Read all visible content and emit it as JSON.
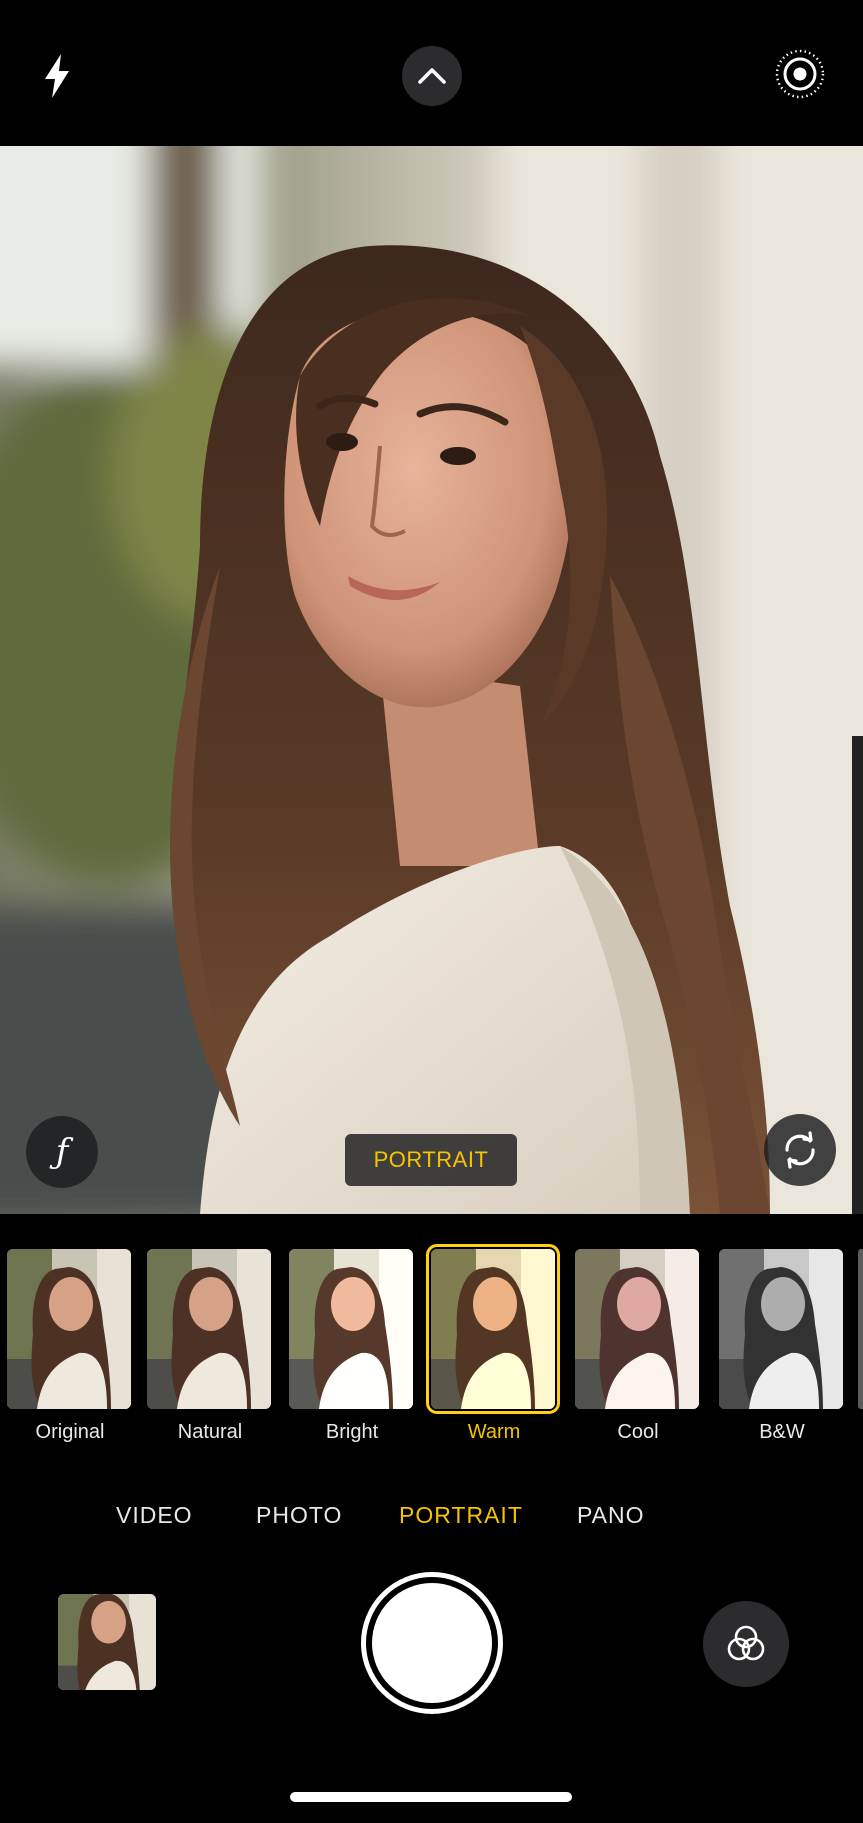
{
  "top_bar": {
    "flash_icon": "lightning-bolt",
    "controls_icon": "chevron-up",
    "live_icon": "concentric-circles"
  },
  "viewfinder": {
    "aperture_label": "ƒ",
    "mode_badge": "PORTRAIT",
    "flip_icon": "rotate-camera"
  },
  "filters": {
    "items": [
      {
        "label": "Original",
        "tone": "original"
      },
      {
        "label": "Natural",
        "tone": "natural"
      },
      {
        "label": "Bright",
        "tone": "bright"
      },
      {
        "label": "Warm",
        "tone": "warm"
      },
      {
        "label": "Cool",
        "tone": "cool"
      },
      {
        "label": "B&W",
        "tone": "bw"
      }
    ],
    "selected": "Warm"
  },
  "modes": {
    "items": [
      "VIDEO",
      "PHOTO",
      "PORTRAIT",
      "PANO"
    ],
    "active": "PORTRAIT"
  },
  "bottom": {
    "filters_icon": "overlapping-circles"
  },
  "colors": {
    "accent": "#f5c400",
    "control_bg": "#2c2c2e"
  }
}
